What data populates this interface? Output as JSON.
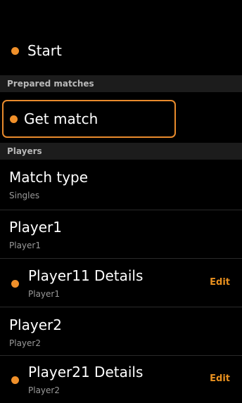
{
  "accent_color": "#f0902a",
  "start": {
    "label": "Start",
    "icon": "orange-dot"
  },
  "sections": {
    "prepared": "Prepared matches",
    "players": "Players"
  },
  "get_match": {
    "label": "Get match",
    "icon": "orange-dot"
  },
  "rows": [
    {
      "title": "Match type",
      "subtitle": "Singles"
    },
    {
      "title": "Player1",
      "subtitle": "Player1"
    },
    {
      "title": "Player11 Details",
      "subtitle": "Player1",
      "action": "Edit"
    },
    {
      "title": "Player2",
      "subtitle": "Player2"
    },
    {
      "title": "Player21 Details",
      "subtitle": "Player2",
      "action": "Edit"
    }
  ]
}
